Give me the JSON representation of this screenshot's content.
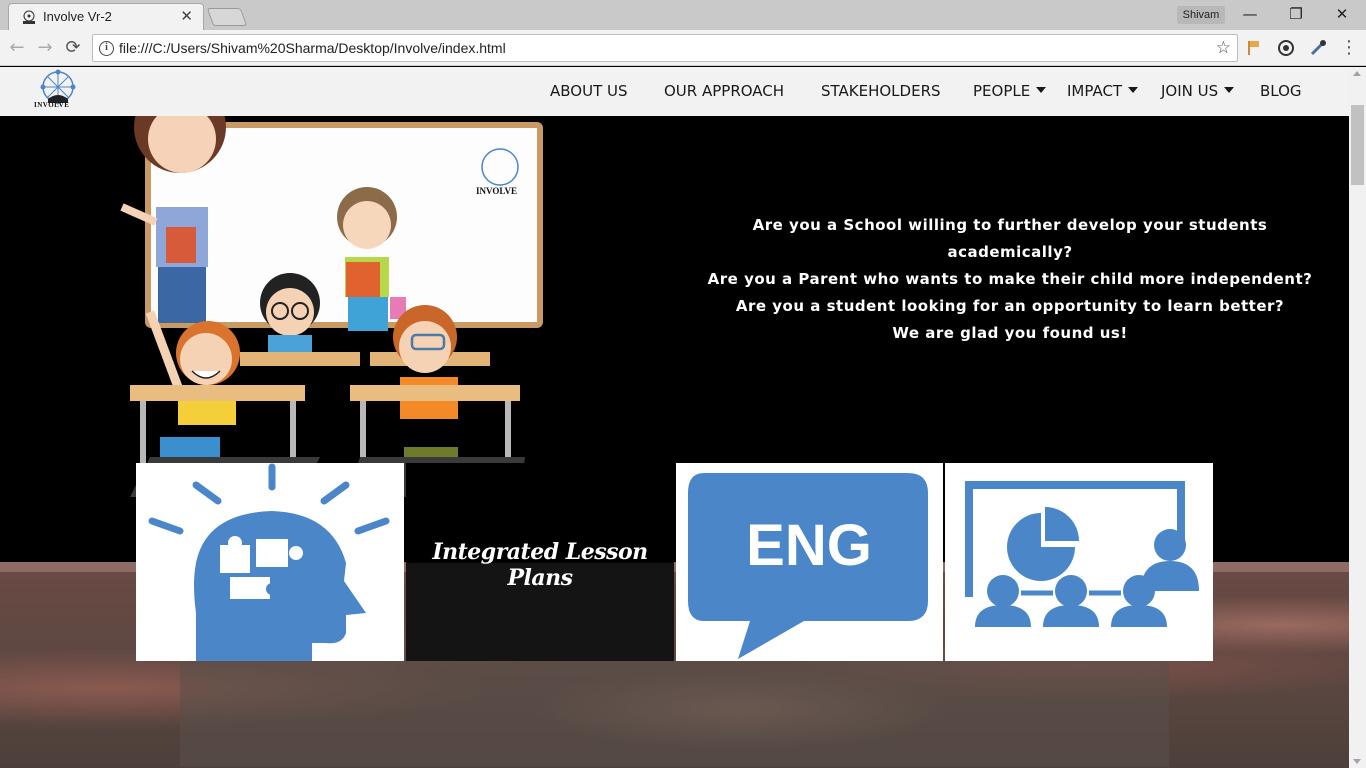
{
  "browser": {
    "tab_title": "Involve Vr-2",
    "tab_close": "✕",
    "profile_name": "Shivam",
    "url": "file:///C:/Users/Shivam%20Sharma/Desktop/Involve/index.html",
    "window_controls": {
      "minimize": "—",
      "restore": "❐",
      "close": "✕"
    },
    "nav_icons": {
      "back": "←",
      "forward": "→",
      "reload": "⟳",
      "info": "i",
      "star": "☆",
      "menu": "⋮"
    }
  },
  "site": {
    "logo_text": "INVOLVE",
    "nav": [
      {
        "label": "ABOUT US",
        "dropdown": false
      },
      {
        "label": "OUR APPROACH",
        "dropdown": false
      },
      {
        "label": "STAKEHOLDERS",
        "dropdown": false
      },
      {
        "label": "PEOPLE",
        "dropdown": true
      },
      {
        "label": "IMPACT",
        "dropdown": true
      },
      {
        "label": "JOIN US",
        "dropdown": true
      },
      {
        "label": "BLOG",
        "dropdown": false
      }
    ],
    "hero_lines": [
      "Are you a School willing to further develop your students academically?",
      "Are you a Parent who wants to make their child more independent?",
      "Are you a student looking for an opportunity to learn better?",
      "We are glad you found us!"
    ],
    "whiteboard_logo": "INVOLVE",
    "tiles": [
      {
        "icon": "head-puzzle-icon",
        "caption": ""
      },
      {
        "icon": "",
        "caption": "Integrated Lesson Plans"
      },
      {
        "icon": "eng-speech-bubble-icon",
        "caption": "ENG"
      },
      {
        "icon": "presentation-board-icon",
        "caption": ""
      }
    ],
    "colors": {
      "icon_blue": "#4a86c8",
      "nav_bg": "#f2f2f2",
      "hero_bg": "#000000"
    }
  }
}
